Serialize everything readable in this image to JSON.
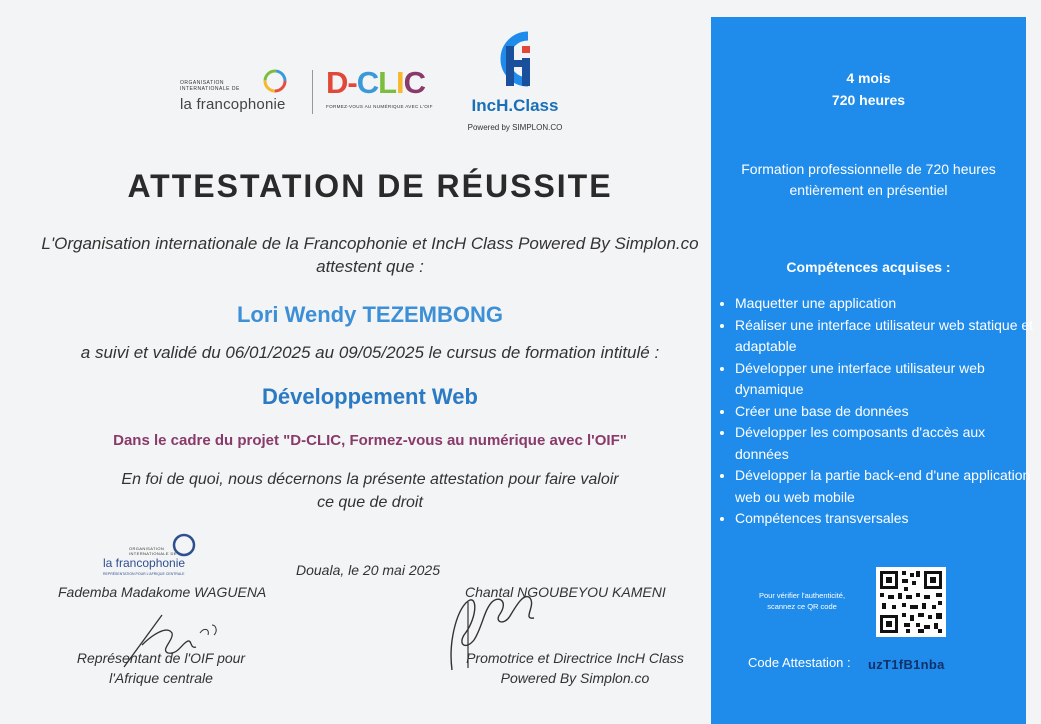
{
  "logos": {
    "oif_small": "ORGANISATION\nINTERNATIONALE DE",
    "oif_name": "la francophonie",
    "dclic_word": "D-CLIC",
    "dclic_tagline": "FORMEZ-VOUS AU NUMÉRIQUE AVEC L'OIF",
    "inch_name": "IncH.Class",
    "inch_powered": "Powered by SIMPLON.CO"
  },
  "certificate": {
    "title": "ATTESTATION DE RÉUSSITE",
    "intro": "L'Organisation internationale de la Francophonie et IncH Class Powered By Simplon.co attestent que :",
    "recipient": "Lori Wendy TEZEMBONG",
    "cursus_line": "a suivi et validé du 06/01/2025 au 09/05/2025 le cursus de formation intitulé :",
    "course": "Développement Web",
    "project": "Dans le cadre du projet \"D-CLIC, Formez-vous au numérique avec l'OIF\"",
    "closing": "En foi de quoi, nous décernons la présente attestation pour faire valoir ce que de droit"
  },
  "signatures": {
    "oif_logo_small": "ORGANISATION\nINTERNATIONALE DE",
    "oif_logo_name": "la francophonie",
    "oif_logo_sub": "REPRÉSENTATION POUR L'AFRIQUE CENTRALE",
    "left_name": "Fademba Madakome WAGUENA",
    "left_role": "Représentant de l'OIF pour l'Afrique centrale",
    "date": "Douala, le 20 mai 2025",
    "right_name": "Chantal NGOUBEYOU KAMENI",
    "right_role": "Promotrice et Directrice IncH Class Powered By Simplon.co"
  },
  "panel": {
    "duration_months": "4 mois",
    "duration_hours": "720 heures",
    "formation": "Formation professionnelle de 720 heures entièrement en présentiel",
    "skills_title": "Compétences acquises :",
    "skills": [
      "Maquetter une application",
      "Réaliser une interface utilisateur web statique et adaptable",
      "Développer une interface utilisateur web dynamique",
      "Créer une base de données",
      "Développer les composants d'accès aux données",
      "Développer la partie back-end d'une application web ou web mobile",
      "Compétences transversales"
    ],
    "verify_text": "Pour vérifier l'authenticité, scannez ce QR code",
    "code_label": "Code Attestation :",
    "code_value": "uzT1fB1nba"
  },
  "colors": {
    "panel_blue": "#1f8ceb",
    "name_blue": "#3d8fd6",
    "course_blue": "#2b7ac4",
    "project_purple": "#8a3a6a"
  }
}
